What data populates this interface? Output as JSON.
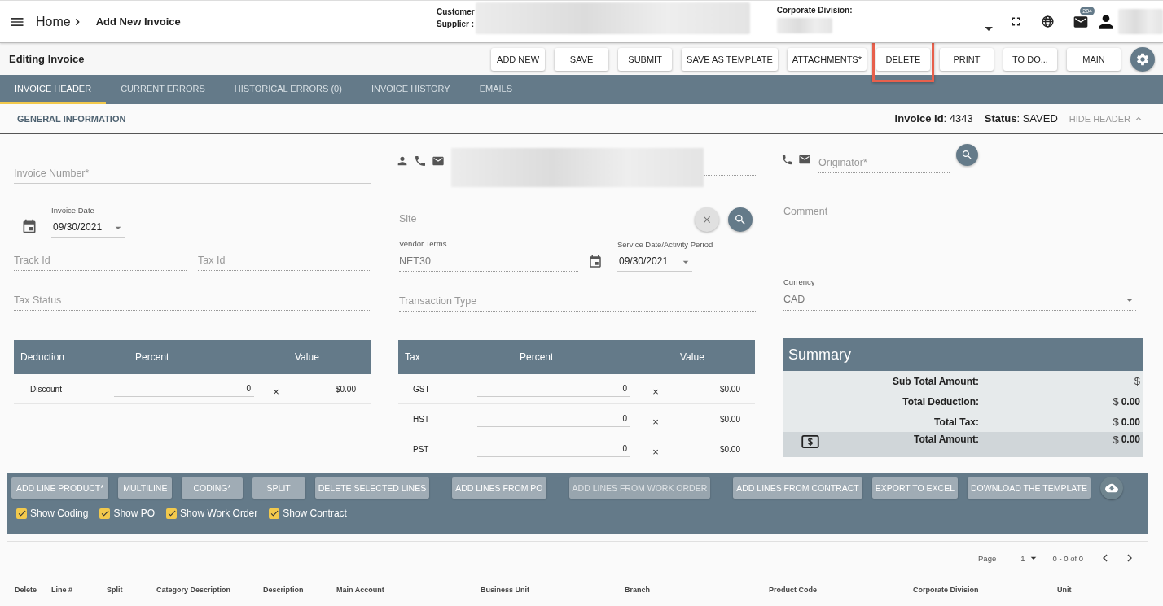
{
  "header": {
    "home": "Home",
    "page_title": "Add New Invoice",
    "customer_label": "Customer",
    "supplier_label": "Supplier :",
    "corporate_division_label": "Corporate Division:",
    "mail_badge": "204"
  },
  "toolbar": {
    "title": "Editing Invoice",
    "buttons": [
      {
        "label": "ADD NEW",
        "highlighted": false
      },
      {
        "label": "SAVE",
        "highlighted": false
      },
      {
        "label": "SUBMIT",
        "highlighted": false
      },
      {
        "label": "SAVE AS TEMPLATE",
        "highlighted": false
      },
      {
        "label": "ATTACHMENTS*",
        "highlighted": false
      },
      {
        "label": "DELETE",
        "highlighted": true
      },
      {
        "label": "PRINT",
        "highlighted": false
      },
      {
        "label": "TO DO...",
        "highlighted": false
      },
      {
        "label": "MAIN",
        "highlighted": false
      }
    ]
  },
  "tabs": [
    {
      "label": "INVOICE HEADER",
      "selected": true
    },
    {
      "label": "CURRENT ERRORS",
      "selected": false
    },
    {
      "label": "HISTORICAL ERRORS (0)",
      "selected": false
    },
    {
      "label": "INVOICE HISTORY",
      "selected": false
    },
    {
      "label": "EMAILS",
      "selected": false
    }
  ],
  "info": {
    "section": "GENERAL INFORMATION",
    "invoice_id": "**Invoice Id**: 4343",
    "status": "**Status**: SAVED",
    "hide_header": "HIDE HEADER"
  },
  "form": {
    "invoice_number": {
      "placeholder": "Invoice Number*"
    },
    "invoice_date": {
      "label": "Invoice Date",
      "value": "09/30/2021"
    },
    "track_id": {
      "placeholder": "Track Id"
    },
    "tax_id": {
      "placeholder": "Tax Id"
    },
    "tax_status": {
      "placeholder": "Tax Status"
    },
    "site": {
      "placeholder": "Site"
    },
    "vendor_terms": {
      "label": "Vendor Terms",
      "value": "NET30"
    },
    "service_date": {
      "label": "Service Date/Activity Period",
      "value": "09/30/2021"
    },
    "transaction_type": {
      "placeholder": "Transaction Type"
    },
    "originator": {
      "placeholder": "Originator*"
    },
    "comment": {
      "placeholder": "Comment"
    },
    "currency": {
      "label": "Currency",
      "value": "CAD"
    }
  },
  "deductions": {
    "columns": [
      "Deduction",
      "Percent",
      "Value"
    ],
    "rows": [
      {
        "name": "Discount",
        "percent": "0",
        "remove": "×",
        "value": "$0.00"
      }
    ]
  },
  "taxes": {
    "columns": [
      "Tax",
      "Percent",
      "Value"
    ],
    "rows": [
      {
        "name": "GST",
        "percent": "0",
        "remove": "×",
        "value": "$0.00"
      },
      {
        "name": "HST",
        "percent": "0",
        "remove": "×",
        "value": "$0.00"
      },
      {
        "name": "PST",
        "percent": "0",
        "remove": "×",
        "value": "$0.00"
      }
    ]
  },
  "summary": {
    "title": "Summary",
    "rows": [
      {
        "kind": "plain",
        "label": "Sub Total Amount:",
        "currency": "$"
      },
      {
        "kind": "plain",
        "label": "Total Deduction:",
        "currency": "$",
        "amount": "0.00"
      },
      {
        "kind": "plain",
        "label": "Total Tax:",
        "currency": "$",
        "amount": "0.00"
      },
      {
        "kind": "total",
        "label": "Total Amount:",
        "currency": "$",
        "amount": "0.00"
      }
    ]
  },
  "line_actions": {
    "buttons": [
      {
        "label": "ADD LINE PRODUCT*",
        "disabled": false
      },
      {
        "label": "MULTILINE",
        "disabled": false
      },
      {
        "label": "CODING*",
        "disabled": false
      },
      {
        "label": "SPLIT",
        "disabled": false
      },
      {
        "label": "DELETE SELECTED LINES",
        "disabled": false
      },
      {
        "label": "ADD LINES FROM PO",
        "disabled": false
      },
      {
        "label": "ADD LINES FROM WORK ORDER",
        "disabled": true
      },
      {
        "label": "ADD LINES FROM CONTRACT",
        "disabled": false
      },
      {
        "label": "EXPORT TO EXCEL",
        "disabled": false
      },
      {
        "label": "DOWNLOAD THE TEMPLATE",
        "disabled": false
      }
    ],
    "checkboxes": [
      {
        "label": "Show Coding",
        "checked": true
      },
      {
        "label": "Show PO",
        "checked": true
      },
      {
        "label": "Show Work Order",
        "checked": true
      },
      {
        "label": "Show Contract",
        "checked": true
      }
    ]
  },
  "pagination": {
    "page_label": "Page",
    "page": "1",
    "range": "0 - 0 of 0"
  },
  "lines_table": {
    "columns": [
      "Delete",
      "Line #",
      "Split",
      "Category Description",
      "Description",
      "Main Account",
      "Business Unit",
      "Branch",
      "Product Code",
      "Corporate Division",
      "Unit"
    ]
  }
}
